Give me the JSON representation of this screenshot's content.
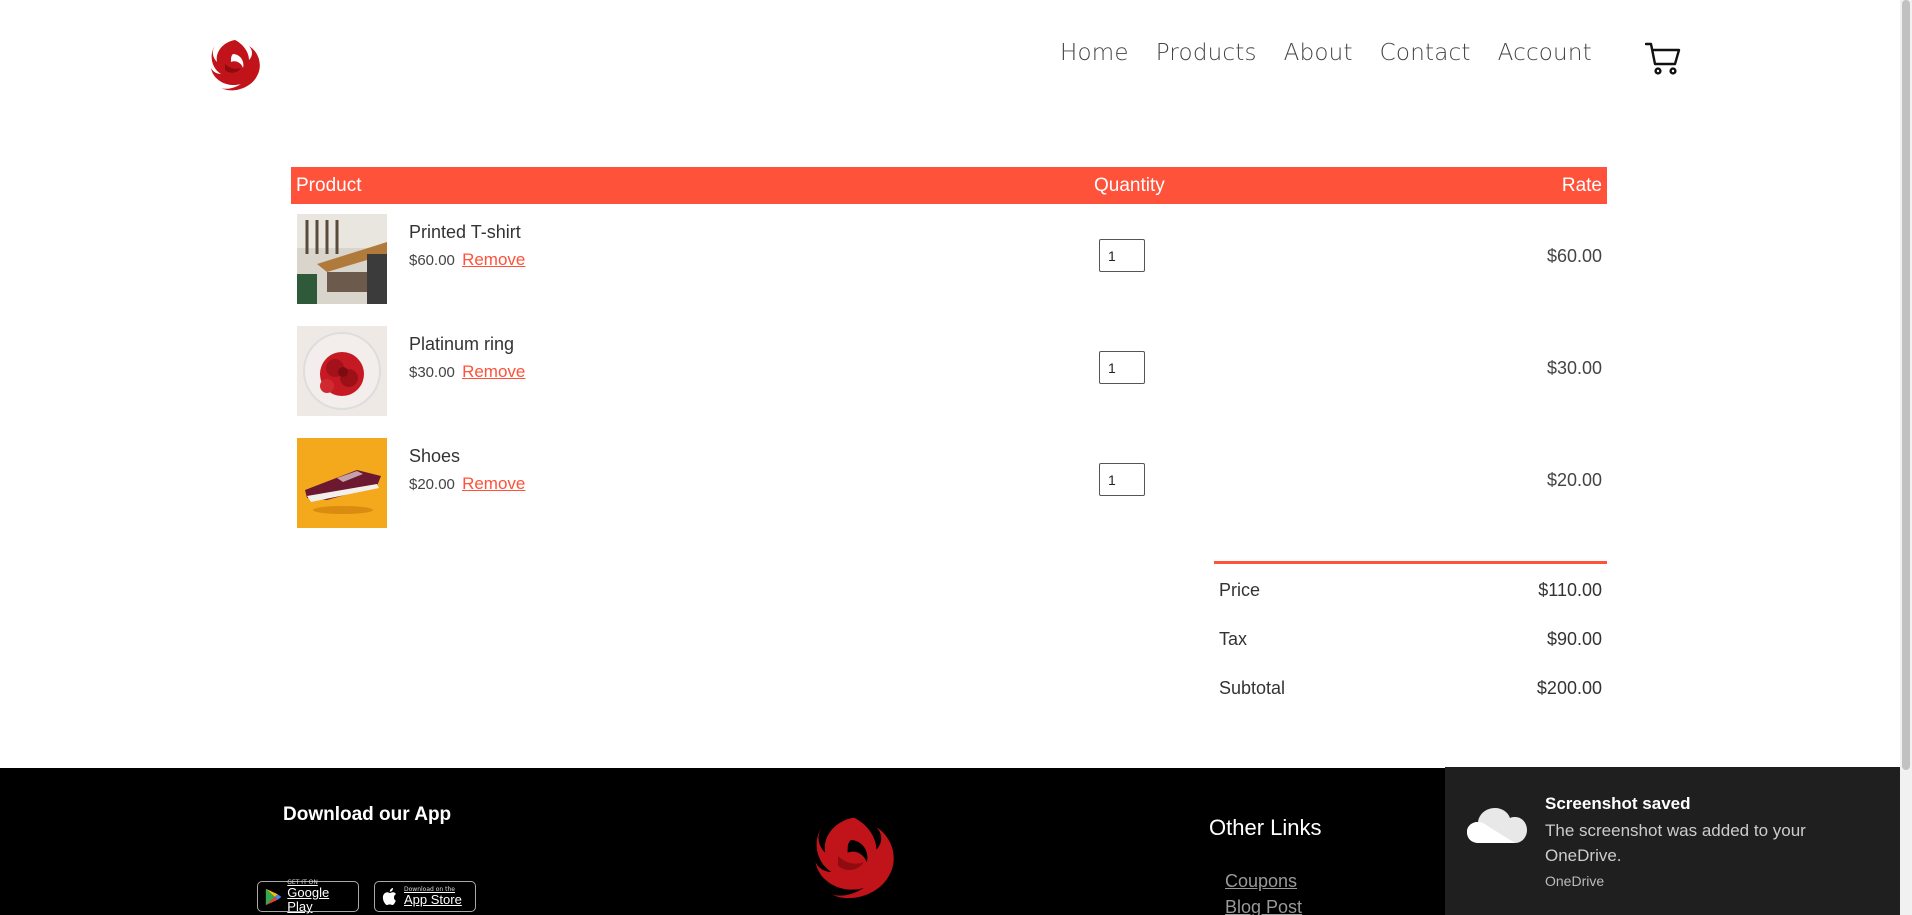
{
  "header": {
    "nav": [
      "Home",
      "Products",
      "About",
      "Contact",
      "Account"
    ],
    "logo_icon": "phoenix-logo-icon",
    "cart_icon": "shopping-cart-icon",
    "accent": "#c0141a"
  },
  "cart": {
    "headers": {
      "product": "Product",
      "quantity": "Quantity",
      "rate": "Rate"
    },
    "items": [
      {
        "name": "Printed T-shirt",
        "price": "$60.00",
        "remove": "Remove",
        "qty": "1",
        "rate": "$60.00",
        "thumb": "room-photo"
      },
      {
        "name": "Platinum ring",
        "price": "$30.00",
        "remove": "Remove",
        "qty": "1",
        "rate": "$30.00",
        "thumb": "red-rose-photo"
      },
      {
        "name": "Shoes",
        "price": "$20.00",
        "remove": "Remove",
        "qty": "1",
        "rate": "$20.00",
        "thumb": "sneaker-photo"
      }
    ],
    "accent": "#ff523b"
  },
  "totals": [
    {
      "label": "Price",
      "value": "$110.00"
    },
    {
      "label": "Tax",
      "value": "$90.00"
    },
    {
      "label": "Subtotal",
      "value": "$200.00"
    }
  ],
  "footer": {
    "app_title": "Download our App",
    "google_play": {
      "small": "GET IT ON",
      "big": "Google Play"
    },
    "app_store": {
      "small": "Download on the",
      "big": "App Store"
    },
    "other_title": "Other Links",
    "links": [
      "Coupons",
      "Blog Post"
    ]
  },
  "toast": {
    "title": "Screenshot saved",
    "body": "The screenshot was added to your OneDrive.",
    "source": "OneDrive"
  }
}
